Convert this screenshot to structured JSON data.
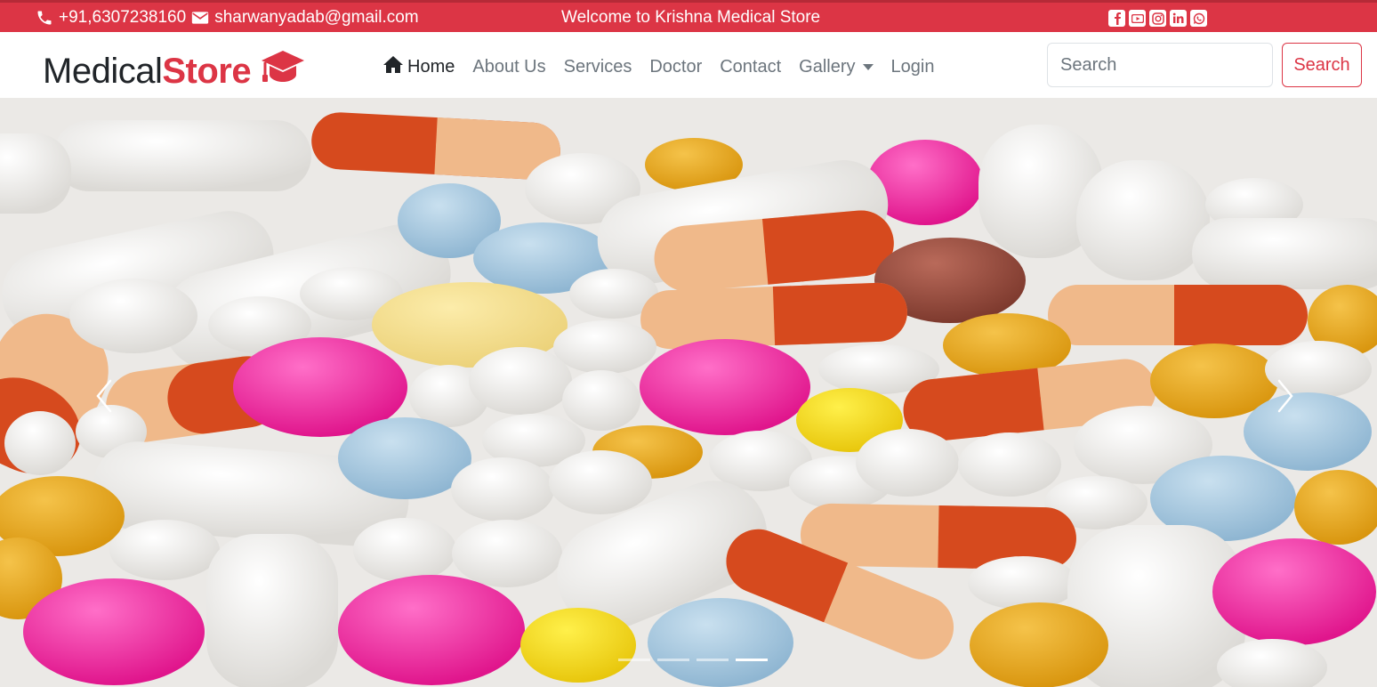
{
  "topbar": {
    "phone": "+91,6307238160",
    "email": "sharwanyadab@gmail.com",
    "welcome": "Welcome to Krishna Medical Store",
    "socials": [
      "facebook-icon",
      "youtube-icon",
      "instagram-icon",
      "linkedin-icon",
      "whatsapp-icon"
    ],
    "bg_color": "#dc3545"
  },
  "navbar": {
    "brand_part1": "Medical",
    "brand_part2": "Store",
    "brand_icon": "graduation-cap-icon",
    "brand_color": "#dc3545",
    "items": [
      {
        "label": "Home",
        "icon": "home-icon",
        "active": true
      },
      {
        "label": "About Us"
      },
      {
        "label": "Services"
      },
      {
        "label": "Doctor"
      },
      {
        "label": "Contact"
      },
      {
        "label": "Gallery",
        "dropdown": true
      },
      {
        "label": "Login"
      }
    ],
    "search": {
      "placeholder": "Search",
      "button_label": "Search"
    }
  },
  "carousel": {
    "slide_count": 4,
    "active_index": 3,
    "prev_icon": "chevron-left-icon",
    "next_icon": "chevron-right-icon"
  }
}
